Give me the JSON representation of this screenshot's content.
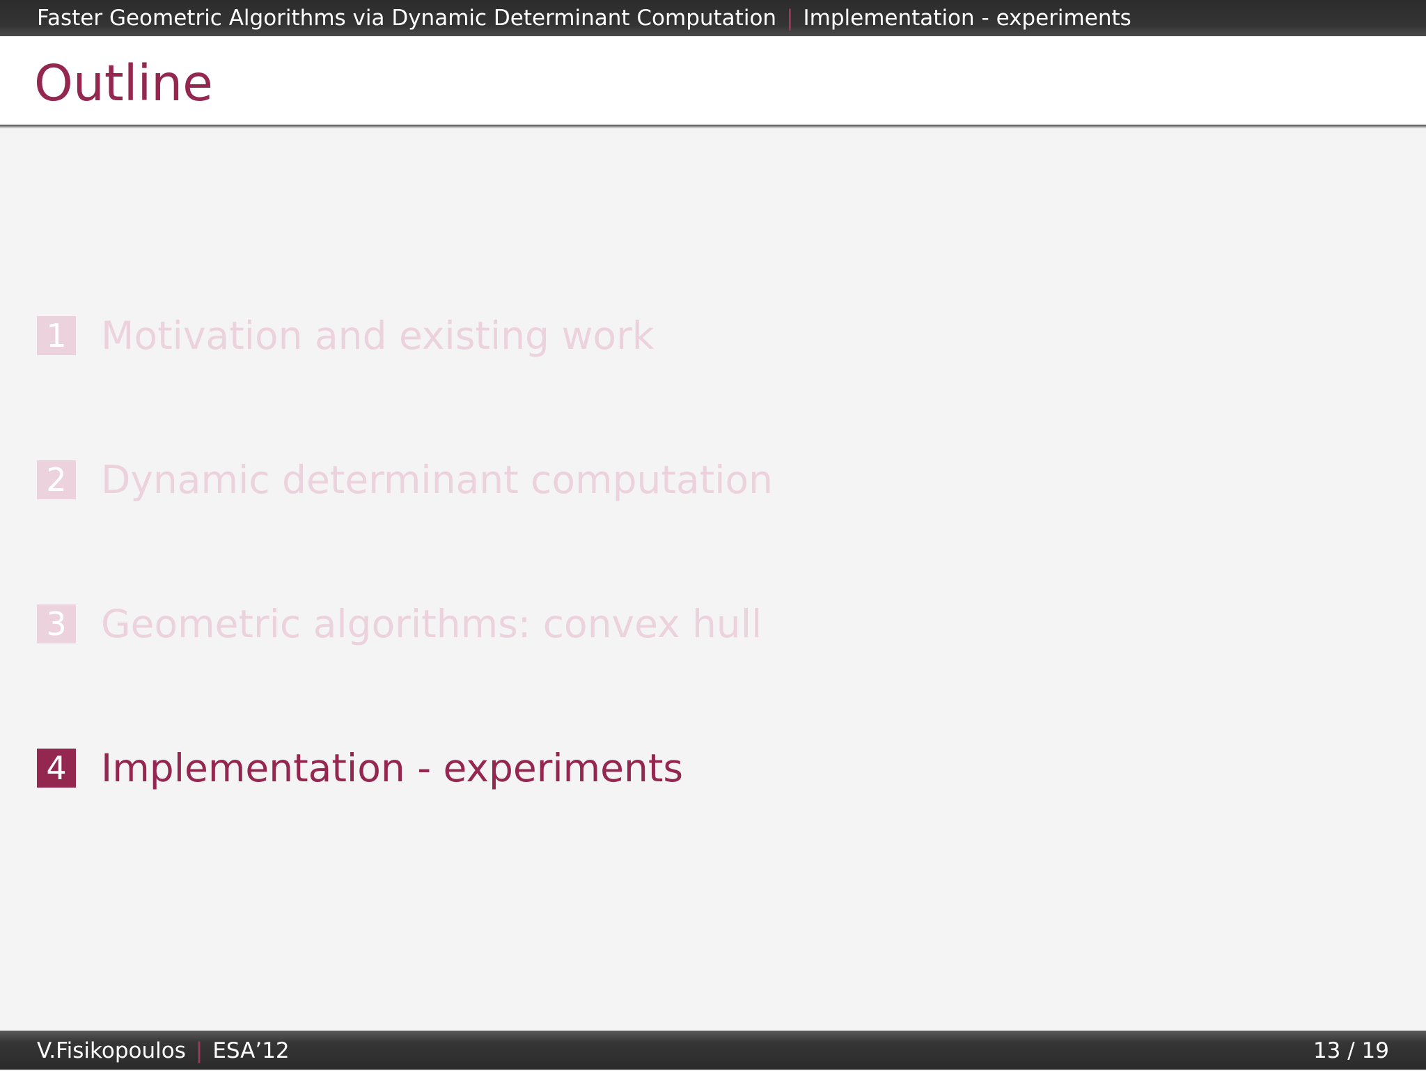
{
  "header": {
    "presentation_title": "Faster Geometric Algorithms via Dynamic Determinant Computation",
    "separator": "|",
    "current_section": "Implementation - experiments"
  },
  "frame": {
    "title": "Outline"
  },
  "outline": {
    "items": [
      {
        "number": "1",
        "label": "Motivation and existing work",
        "state": "faded"
      },
      {
        "number": "2",
        "label": "Dynamic determinant computation",
        "state": "faded"
      },
      {
        "number": "3",
        "label": "Geometric algorithms: convex hull",
        "state": "faded"
      },
      {
        "number": "4",
        "label": "Implementation - experiments",
        "state": "active"
      }
    ]
  },
  "footer": {
    "author": "V.Fisikopoulos",
    "separator": "|",
    "venue": "ESA’12",
    "page_number": "13 / 19"
  },
  "colors": {
    "accent": "#94274f",
    "faded_accent": "#ecd2dc",
    "bar_background": "#2c2c2c",
    "page_background": "#f5f4f5"
  }
}
